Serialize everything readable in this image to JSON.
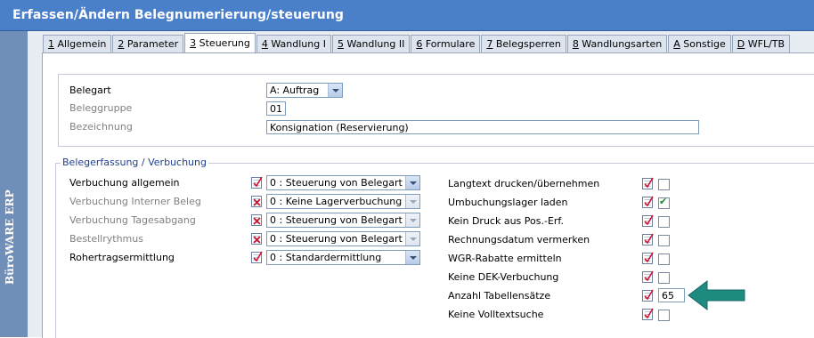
{
  "window": {
    "title": "Erfassen/Ändern Belegnumerierung/steuerung"
  },
  "sidebar": {
    "brand": "BüroWARE ERP"
  },
  "tabs": [
    {
      "key": "1",
      "rest": " Allgemein"
    },
    {
      "key": "2",
      "rest": " Parameter"
    },
    {
      "key": "3",
      "rest": " Steuerung",
      "active": true
    },
    {
      "key": "4",
      "rest": " Wandlung I"
    },
    {
      "key": "5",
      "rest": " Wandlung II"
    },
    {
      "key": "6",
      "rest": " Formulare"
    },
    {
      "key": "7",
      "rest": " Belegsperren"
    },
    {
      "key": "8",
      "rest": " Wandlungsarten"
    },
    {
      "key": "A",
      "rest": " Sonstige"
    },
    {
      "key": "D",
      "rest": " WFL/TB"
    }
  ],
  "header_fields": {
    "belegart_label": "Belegart",
    "belegart_value": "A: Auftrag",
    "beleggruppe_label": "Beleggruppe",
    "beleggruppe_value": "01",
    "bezeichnung_label": "Bezeichnung",
    "bezeichnung_value": "Konsignation (Reservierung)"
  },
  "group": {
    "label": "Belegerfassung / Verbuchung"
  },
  "left_rows": [
    {
      "label": "Verbuchung allgemein",
      "value": "0 : Steuerung von Belegart",
      "enabled": true
    },
    {
      "label": "Verbuchung Interner Beleg",
      "value": "0 : Keine Lagerverbuchung",
      "enabled": false
    },
    {
      "label": "Verbuchung Tagesabgang",
      "value": "0 : Steuerung von Belegart",
      "enabled": false
    },
    {
      "label": "Bestellrythmus",
      "value": "0 : Steuerung von Belegart",
      "enabled": false
    },
    {
      "label": "Rohertragsermittlung",
      "value": "0 : Standardermittlung",
      "enabled": true
    }
  ],
  "right_rows": [
    {
      "label": "Langtext drucken/übernehmen",
      "checked": false
    },
    {
      "label": "Umbuchungslager laden",
      "checked": true
    },
    {
      "label": "Kein Druck aus Pos.-Erf.",
      "checked": false
    },
    {
      "label": "Rechnungsdatum vermerken",
      "checked": false
    },
    {
      "label": "WGR-Rabatte ermitteln",
      "checked": false
    },
    {
      "label": "Keine DEK-Verbuchung",
      "checked": false
    },
    {
      "label": "Anzahl Tabellensätze",
      "value": "65"
    },
    {
      "label": "Keine Volltextsuche",
      "checked": false
    }
  ],
  "colors": {
    "titlebar": "#4a7fc9",
    "sidebar": "#6f8fb8",
    "arrow": "#1f8a7f"
  }
}
